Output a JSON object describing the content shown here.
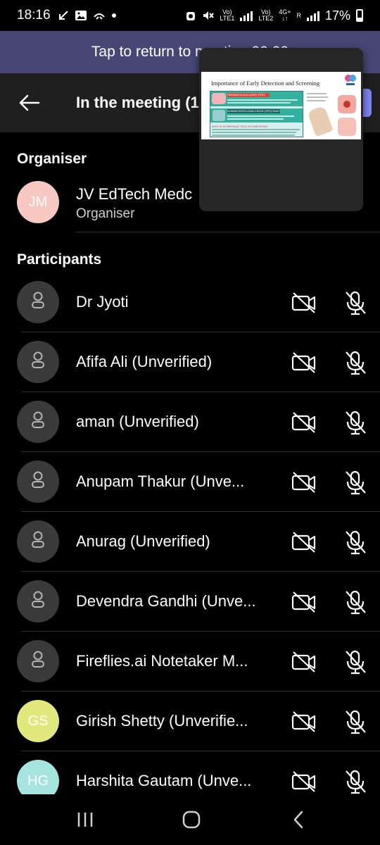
{
  "status_bar": {
    "time": "18:16",
    "lte1_top": "Vo)",
    "lte1_bottom": "LTE1",
    "lte2_top": "Vo)",
    "lte2_bottom": "LTE2",
    "net_top": "4G+",
    "net_bottom": "↓↑",
    "roaming": "R",
    "battery": "17%"
  },
  "banner": {
    "text": "Tap to return to meeting 00:00"
  },
  "header": {
    "title": "In the meeting (1"
  },
  "organiser": {
    "heading": "Organiser",
    "initials": "JM",
    "name": "JV EdTech Medc",
    "role": "Organiser",
    "avatar_color": "#f7c8c2"
  },
  "participants": {
    "heading": "Participants",
    "items": [
      {
        "name": "Dr Jyoti",
        "initials": ""
      },
      {
        "name": "Afifa Ali (Unverified)",
        "initials": ""
      },
      {
        "name": "aman  (Unverified)",
        "initials": ""
      },
      {
        "name": "Anupam Thakur  (Unve...",
        "initials": ""
      },
      {
        "name": "Anurag (Unverified)",
        "initials": ""
      },
      {
        "name": "Devendra Gandhi (Unve...",
        "initials": ""
      },
      {
        "name": "Fireflies.ai Notetaker M...",
        "initials": ""
      },
      {
        "name": "Girish Shetty (Unverifie...",
        "initials": "GS",
        "avatar_color": "#e2e87c"
      },
      {
        "name": "Harshita Gautam (Unve...",
        "initials": "HG",
        "avatar_color": "#a6e4df"
      }
    ]
  },
  "pip": {
    "slide_title": "Importance of Early Detection and Screening",
    "heading1": "PAPANICOLAOU (PAP) TEST",
    "heading2": "HUMAN PAPILLOMA VIRUS (HPV) DNA TEST",
    "heading3": "WHY IS SCREENING TEST SO IMPORTANT?"
  },
  "colors": {
    "banner": "#464775",
    "header": "#1f1f1f",
    "accent": "#7f85f5"
  }
}
